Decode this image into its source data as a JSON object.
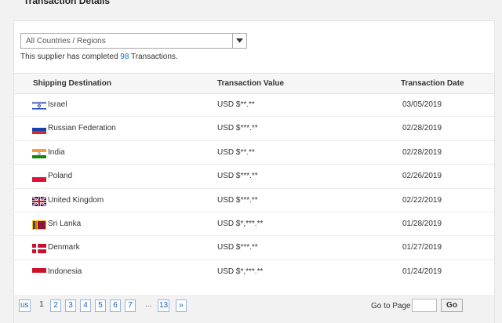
{
  "header": {
    "title": "Transaction Details"
  },
  "filter": {
    "selected": "All Countries / Regions"
  },
  "summary": {
    "prefix": "This supplier has completed",
    "count": "98",
    "suffix": "Transactions."
  },
  "table": {
    "columns": [
      "Shipping Destination",
      "Transaction Value",
      "Transaction Date"
    ],
    "rows": [
      {
        "country": "Israel",
        "flag": "israel-flag-icon",
        "value": "USD $**.**",
        "date": "03/05/2019"
      },
      {
        "country": "Russian Federation",
        "flag": "russia-flag-icon",
        "value": "USD $***.**",
        "date": "02/28/2019"
      },
      {
        "country": "India",
        "flag": "india-flag-icon",
        "value": "USD $**.**",
        "date": "02/28/2019"
      },
      {
        "country": "Poland",
        "flag": "poland-flag-icon",
        "value": "USD $***.**",
        "date": "02/26/2019"
      },
      {
        "country": "United Kingdom",
        "flag": "uk-flag-icon",
        "value": "USD $***.**",
        "date": "02/22/2019"
      },
      {
        "country": "Sri Lanka",
        "flag": "sri-lanka-flag-icon",
        "value": "USD $*,***.**",
        "date": "01/28/2019"
      },
      {
        "country": "Denmark",
        "flag": "denmark-flag-icon",
        "value": "USD $***.**",
        "date": "01/27/2019"
      },
      {
        "country": "Indonesia",
        "flag": "indonesia-flag-icon",
        "value": "USD $*,***.**",
        "date": "01/24/2019"
      }
    ]
  },
  "pagination": {
    "prev": "us",
    "pages": [
      "1",
      "2",
      "3",
      "4",
      "5",
      "6",
      "7"
    ],
    "ellipsis": "...",
    "last": "13",
    "next": "»",
    "current_page": "1",
    "goto_label": "Go to Page",
    "go_button": "Go"
  },
  "colors": {
    "link": "#1a6fc4",
    "header_bg": "#f6f6f6",
    "page_bg": "#f2f2f2"
  }
}
